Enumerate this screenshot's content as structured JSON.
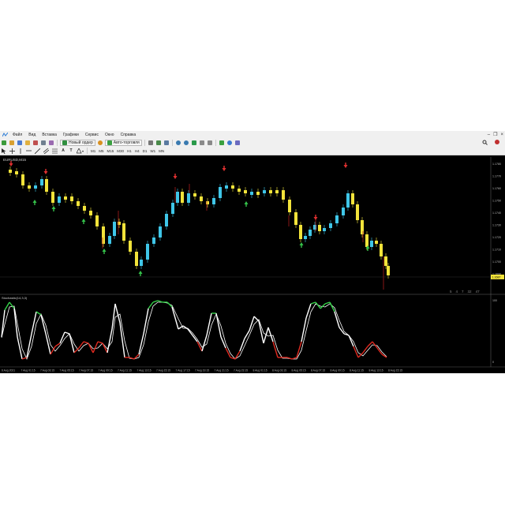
{
  "menu": {
    "items": [
      "Файл",
      "Вид",
      "Вставка",
      "Графики",
      "Сервис",
      "Окно",
      "Справка"
    ]
  },
  "toolbar": {
    "new_order_label": "Новый ордер",
    "autotrading_label": "Авто-торговля",
    "timeframes": [
      "M1",
      "M5",
      "M15",
      "M30",
      "H1",
      "H4",
      "D1",
      "W1",
      "MN"
    ]
  },
  "chart": {
    "symbol_label": "EURUSD,M15",
    "indicator_label": "Stochastic(14,3,3)",
    "price_ticks": [
      "1.1780",
      "1.1770",
      "1.1760",
      "1.1750",
      "1.1740",
      "1.1730",
      "1.1720",
      "1.1710",
      "1.1700",
      "1.1690"
    ],
    "current_price": "1.1687",
    "osc_ticks": [
      "100",
      "0"
    ],
    "time_labels": [
      "6 Aug 2021",
      "7 Aug 01:15",
      "7 Aug 03:15",
      "7 Aug 05:15",
      "7 Aug 07:15",
      "7 Aug 09:15",
      "7 Aug 11:15",
      "7 Aug 13:15",
      "7 Aug 15:15",
      "7 Aug 17:15",
      "7 Aug 19:15",
      "7 Aug 21:15",
      "7 Aug 23:15",
      "8 Aug 01:15",
      "8 Aug 03:15",
      "8 Aug 05:15",
      "8 Aug 07:15",
      "8 Aug 09:15",
      "8 Aug 11:15",
      "8 Aug 13:15",
      "8 Aug 15:15"
    ],
    "colors": {
      "bull": "#3fc6e8",
      "bear": "#f2e33a",
      "arrow_up": "#35c24a",
      "arrow_down": "#e03030",
      "osc_up": "#35d44a",
      "osc_down": "#e02a20",
      "signal": "#ffffff"
    }
  },
  "bottom_tabs": [
    "5",
    "4",
    "7",
    "32",
    "47"
  ]
}
